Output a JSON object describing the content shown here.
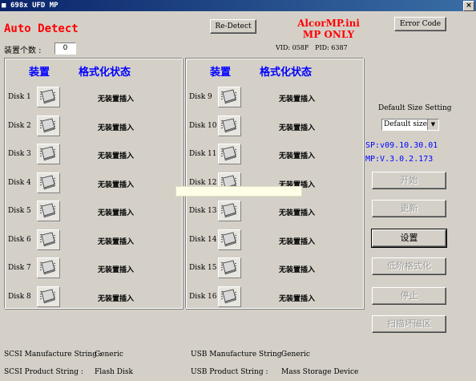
{
  "window": {
    "title": "698x UFD MP",
    "title_icon": "■",
    "close_glyph": "×"
  },
  "header": {
    "auto_detect": "Auto Detect",
    "count_label": "装置个数 :",
    "count_value": "0"
  },
  "buttons": {
    "redetect": "Re-Detect",
    "error_code": "Error Code"
  },
  "ini": {
    "line1": "AlcorMP.ini",
    "line2": "MP ONLY"
  },
  "vid": "VID: 058F",
  "pid": "PID: 6387",
  "panels": [
    {
      "col_device": "装置",
      "col_status": "格式化状态",
      "disks": [
        {
          "label": "Disk 1",
          "status": "无装置插入"
        },
        {
          "label": "Disk 2",
          "status": "无装置插入"
        },
        {
          "label": "Disk 3",
          "status": "无装置插入"
        },
        {
          "label": "Disk 4",
          "status": "无装置插入"
        },
        {
          "label": "Disk 5",
          "status": "无装置插入"
        },
        {
          "label": "Disk 6",
          "status": "无装置插入"
        },
        {
          "label": "Disk 7",
          "status": "无装置插入"
        },
        {
          "label": "Disk 8",
          "status": "无装置插入"
        }
      ]
    },
    {
      "col_device": "装置",
      "col_status": "格式化状态",
      "disks": [
        {
          "label": "Disk 9",
          "status": "无装置插入"
        },
        {
          "label": "Disk 10",
          "status": "无装置插入"
        },
        {
          "label": "Disk 11",
          "status": "无装置插入"
        },
        {
          "label": "Disk 12",
          "status": "无装置插入"
        },
        {
          "label": "Disk 13",
          "status": "无装置插入"
        },
        {
          "label": "Disk 14",
          "status": "无装置插入"
        },
        {
          "label": "Disk 15",
          "status": "无装置插入"
        },
        {
          "label": "Disk 16",
          "status": "无装置插入"
        }
      ]
    }
  ],
  "right": {
    "default_size_label": "Default Size Setting",
    "default_size_value": "Default size",
    "sp_version": "SP:v09.10.30.01",
    "mp_version": "MP:V.3.0.2.173",
    "start": "开始",
    "refresh": "更新",
    "settings": "设置",
    "low_format": "低阶格式化",
    "stop": "停止",
    "scan_bad": "扫描坏磁区"
  },
  "bottom": {
    "scsi_mfr_label": "SCSI Manufacture String :",
    "scsi_mfr_value": "Generic",
    "usb_mfr_label": "USB Manufacture String :",
    "usb_mfr_value": "Generic",
    "scsi_prod_label": "SCSI Product String :",
    "scsi_prod_value": "Flash Disk",
    "usb_prod_label": "USB Product String :",
    "usb_prod_value": "Mass Storage Device"
  }
}
